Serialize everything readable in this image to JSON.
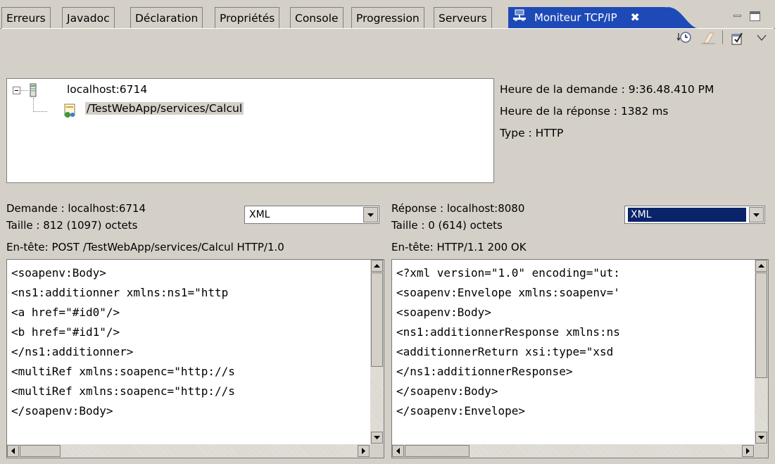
{
  "tabs": [
    "Erreurs",
    "Javadoc",
    "Déclaration",
    "Propriétés",
    "Console",
    "Progression",
    "Serveurs"
  ],
  "active_tab": {
    "label": "Moniteur TCP/IP",
    "close": "✖"
  },
  "tree": {
    "host": "localhost:6714",
    "service": "/TestWebApp/services/Calcul"
  },
  "details": {
    "request_time": "Heure de la demande : 9:36.48.410 PM",
    "response_time": "Heure de la réponse : 1382 ms",
    "type": "Type : HTTP"
  },
  "request": {
    "title": "Demande : localhost:6714",
    "size": "Taille : 812 (1097) octets",
    "header": "En-tête: POST /TestWebApp/services/Calcul HTTP/1.0",
    "format": "XML",
    "lines": [
      "<soapenv:Body>",
      "<ns1:additionner xmlns:ns1=\"http",
      "<a href=\"#id0\"/>",
      "<b href=\"#id1\"/>",
      "</ns1:additionner>",
      "<multiRef xmlns:soapenc=\"http://s",
      "<multiRef xmlns:soapenc=\"http://s",
      "</soapenv:Body>"
    ]
  },
  "response": {
    "title": "Réponse : localhost:8080",
    "size": "Taille : 0 (614) octets",
    "header": "En-tête: HTTP/1.1 200 OK",
    "format": "XML",
    "lines": [
      "<?xml version=\"1.0\" encoding=\"ut:",
      "<soapenv:Envelope xmlns:soapenv='",
      "<soapenv:Body>",
      "<ns1:additionnerResponse xmlns:ns",
      "<additionnerReturn xsi:type=\"xsd",
      "</ns1:additionnerResponse>",
      "</soapenv:Body>",
      "</soapenv:Envelope>"
    ]
  },
  "colors": {
    "active_tab": "#1e4ab8",
    "selection": "#0a246a",
    "chrome": "#d4d0c8"
  },
  "icons": {
    "toolbar": [
      "history-icon",
      "clear-icon",
      "properties-icon",
      "view-menu-icon"
    ]
  }
}
